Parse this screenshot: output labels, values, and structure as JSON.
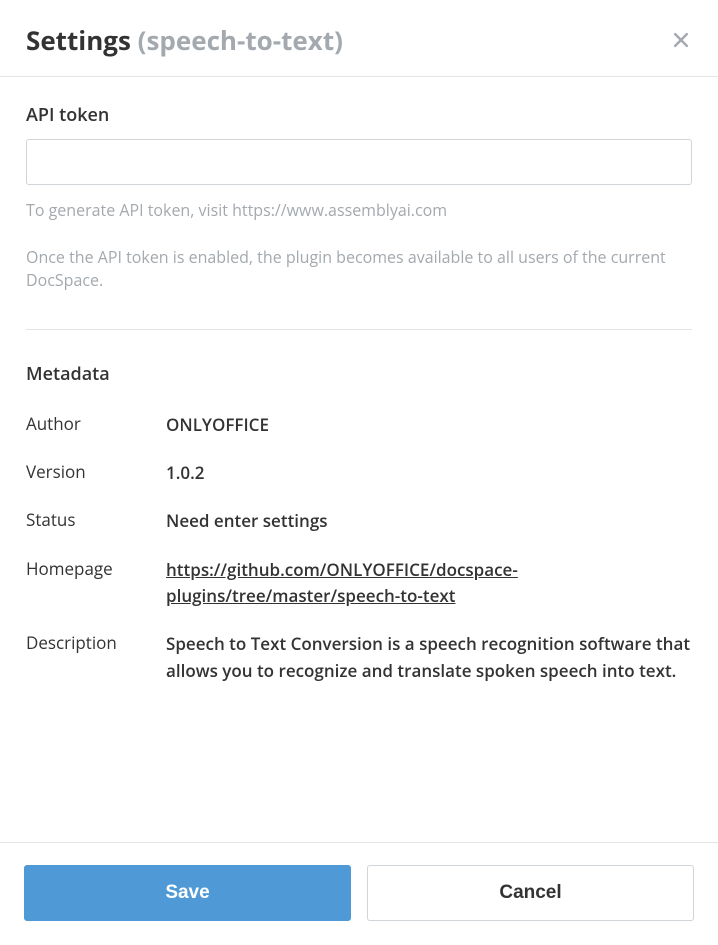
{
  "header": {
    "title": "Settings",
    "subtitle": "(speech-to-text)"
  },
  "apiToken": {
    "label": "API token",
    "value": "",
    "hint1": "To generate API token, visit https://www.assemblyai.com",
    "hint2": "Once the API token is enabled, the plugin becomes available to all users of the current DocSpace."
  },
  "metadata": {
    "sectionTitle": "Metadata",
    "labels": {
      "author": "Author",
      "version": "Version",
      "status": "Status",
      "homepage": "Homepage",
      "description": "Description"
    },
    "values": {
      "author": "ONLYOFFICE",
      "version": "1.0.2",
      "status": "Need enter settings",
      "homepage": "https://github.com/ONLYOFFICE/docspace-plugins/tree/master/speech-to-text",
      "description": "Speech to Text Conversion is a speech recognition software that allows you to recognize and translate spoken speech into text."
    }
  },
  "footer": {
    "save": "Save",
    "cancel": "Cancel"
  }
}
